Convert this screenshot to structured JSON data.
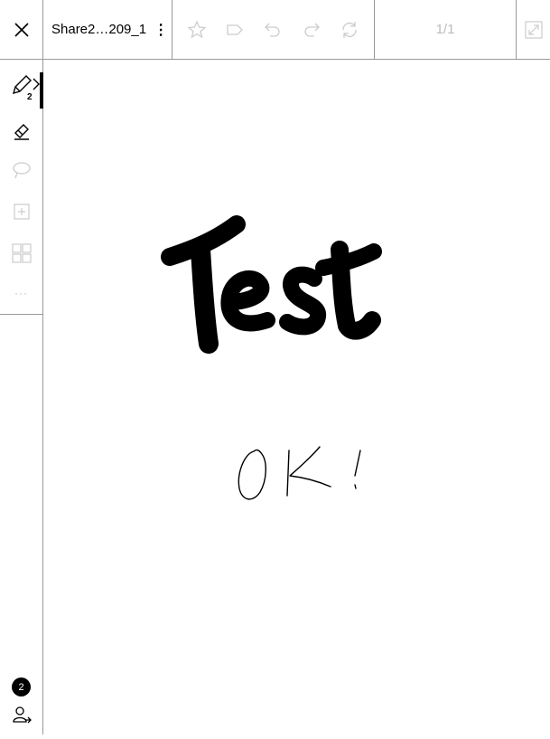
{
  "toolbar": {
    "close_icon": "close-icon",
    "document_title": "Share2…209_1",
    "menu_glyph": "⋮",
    "page_indicator": "1/1",
    "tools": [
      "star-icon",
      "tag-icon",
      "undo-icon",
      "redo-icon",
      "sync-icon"
    ],
    "expand_icon": "expand-icon"
  },
  "sidebar": {
    "items": [
      {
        "icon": "pen-icon",
        "badge": "2",
        "active": true
      },
      {
        "icon": "eraser-icon"
      },
      {
        "icon": "lasso-icon"
      },
      {
        "icon": "add-page-icon"
      },
      {
        "icon": "layout-icon"
      },
      {
        "icon": "more-icon",
        "label": "···"
      }
    ],
    "bottom": {
      "count_badge": "2",
      "share_icon": "user-share-icon"
    }
  },
  "canvas": {
    "handwriting": [
      "Test",
      "OK!"
    ]
  },
  "colors": {
    "ink": "#000000",
    "disabled": "#bbbbbb",
    "divider": "#999999"
  }
}
